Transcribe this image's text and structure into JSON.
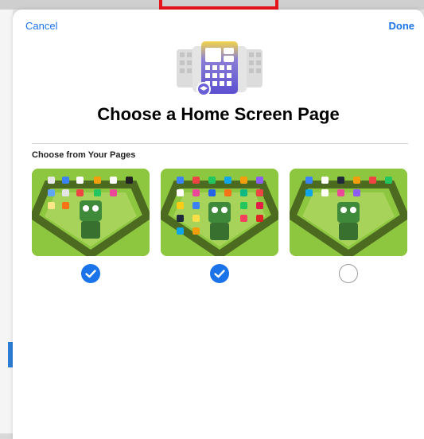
{
  "nav": {
    "cancel_label": "Cancel",
    "done_label": "Done"
  },
  "title": "Choose a Home Screen Page",
  "section_label": "Choose from Your Pages",
  "pages": [
    {
      "selected": true
    },
    {
      "selected": true
    },
    {
      "selected": false
    }
  ],
  "colors": {
    "accent": "#1a73e8",
    "wallpaper_green": "#8dc63f",
    "highlight_red": "#e8141b"
  },
  "icons": [
    "home-screen-pages-icon",
    "checkmark-icon"
  ]
}
